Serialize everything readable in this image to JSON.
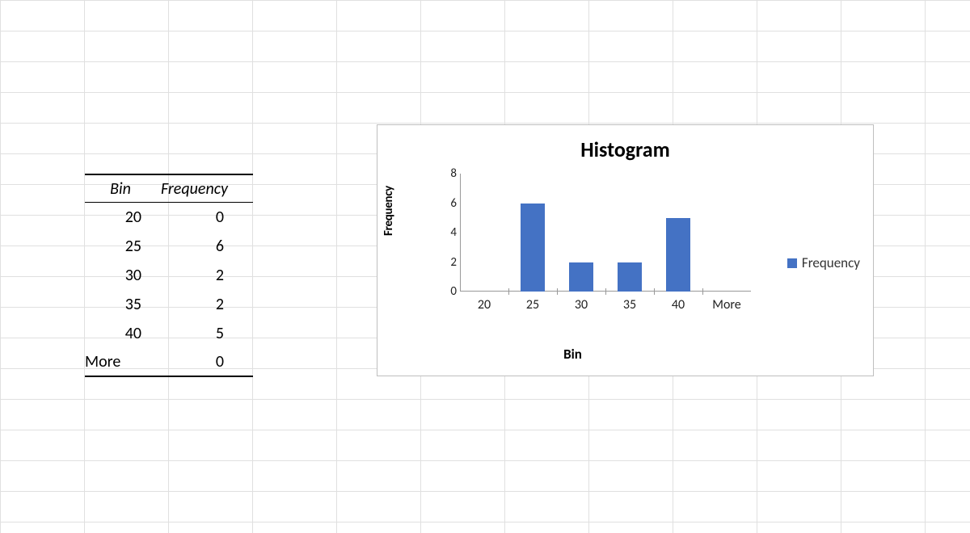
{
  "table": {
    "headers": {
      "bin": "Bin",
      "freq": "Frequency"
    },
    "rows": [
      {
        "bin": "20",
        "freq": "0"
      },
      {
        "bin": "25",
        "freq": "6"
      },
      {
        "bin": "30",
        "freq": "2"
      },
      {
        "bin": "35",
        "freq": "2"
      },
      {
        "bin": "40",
        "freq": "5"
      },
      {
        "bin": "More",
        "freq": "0"
      }
    ]
  },
  "chart_data": {
    "type": "bar",
    "title": "Histogram",
    "xlabel": "Bin",
    "ylabel": "Frequency",
    "categories": [
      "20",
      "25",
      "30",
      "35",
      "40",
      "More"
    ],
    "values": [
      0,
      6,
      2,
      2,
      5,
      0
    ],
    "ylim": [
      0,
      8
    ],
    "yticks": [
      0,
      2,
      4,
      6,
      8
    ],
    "series_name": "Frequency",
    "bar_color": "#4472C4"
  }
}
